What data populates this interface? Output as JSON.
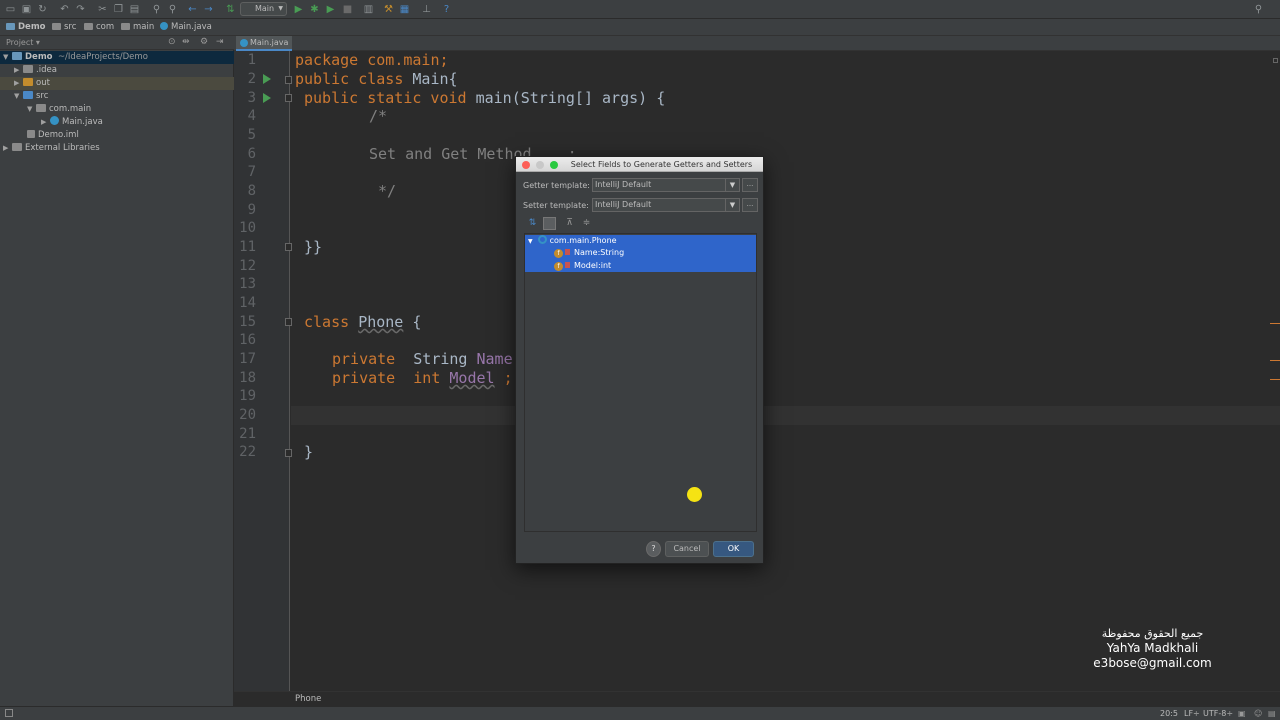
{
  "toolbar": {
    "run_config": "Main",
    "icons": [
      "open-icon",
      "save-icon",
      "sync-icon",
      "undo-icon",
      "redo-icon",
      "cut-icon",
      "copy-icon",
      "paste-icon",
      "find-icon",
      "replace-icon",
      "back-icon",
      "forward-icon",
      "build-icon",
      "run-icon",
      "debug-icon",
      "coverage-icon",
      "stop-icon",
      "project-structure-icon",
      "sdk-icon",
      "vcs-icon",
      "help-icon",
      "search-everywhere-icon"
    ]
  },
  "breadcrumb": [
    "Demo",
    "src",
    "com",
    "main",
    "Main.java"
  ],
  "project_panel": {
    "header": "Project",
    "tree": [
      {
        "label": "Demo",
        "suffix": "~/IdeaProjects/Demo",
        "depth": 0,
        "expanded": true
      },
      {
        "label": ".idea",
        "depth": 1,
        "expanded": false
      },
      {
        "label": "out",
        "depth": 1,
        "expanded": false
      },
      {
        "label": "src",
        "depth": 1,
        "expanded": true
      },
      {
        "label": "com.main",
        "depth": 2,
        "expanded": true
      },
      {
        "label": "Main.java",
        "depth": 3,
        "expanded": false
      },
      {
        "label": "Demo.iml",
        "depth": 1
      },
      {
        "label": "External Libraries",
        "depth": 0,
        "expanded": false
      }
    ]
  },
  "editor": {
    "tab": "Main.java",
    "line_numbers": [
      "1",
      "2",
      "3",
      "4",
      "5",
      "6",
      "7",
      "8",
      "9",
      "10",
      "11",
      "12",
      "13",
      "14",
      "15",
      "16",
      "17",
      "18",
      "19",
      "20",
      "21",
      "22"
    ],
    "lines": {
      "l1": "package com.main;",
      "l2_kw": "public class ",
      "l2_name": "Main{",
      "l3_kw": "public static void ",
      "l3_rest": "main(String[] args) {",
      "l4": "/*",
      "l6": "Set and Get Method    :",
      "l8": "*/",
      "l11": "}}",
      "l15_kw": "class ",
      "l15_name": "Phone",
      "l15_rest": " {",
      "l17_kw": "private  ",
      "l17_type": "String ",
      "l17_name": "Name",
      "l18_kw": "private  int ",
      "l18_name": "Model",
      "l18_rest": " ;",
      "l22": "}"
    },
    "breadcrumb_bottom": "Phone"
  },
  "dialog": {
    "title": "Select Fields to Generate Getters and Setters",
    "getter_label": "Getter template:",
    "getter_value": "IntelliJ Default",
    "setter_label": "Setter template:",
    "setter_value": "IntelliJ Default",
    "more": "...",
    "tree": {
      "class": "com.main.Phone",
      "fields": [
        "Name:String",
        "Model:int"
      ]
    },
    "help": "?",
    "cancel": "Cancel",
    "ok": "OK"
  },
  "status": {
    "position": "20:5",
    "line_sep": "LF÷",
    "encoding": "UTF-8÷"
  },
  "watermark": {
    "line1": "جميع الحقوق محفوظة",
    "line2": "YahYa Madkhali",
    "line3": "e3bose@gmail.com"
  }
}
